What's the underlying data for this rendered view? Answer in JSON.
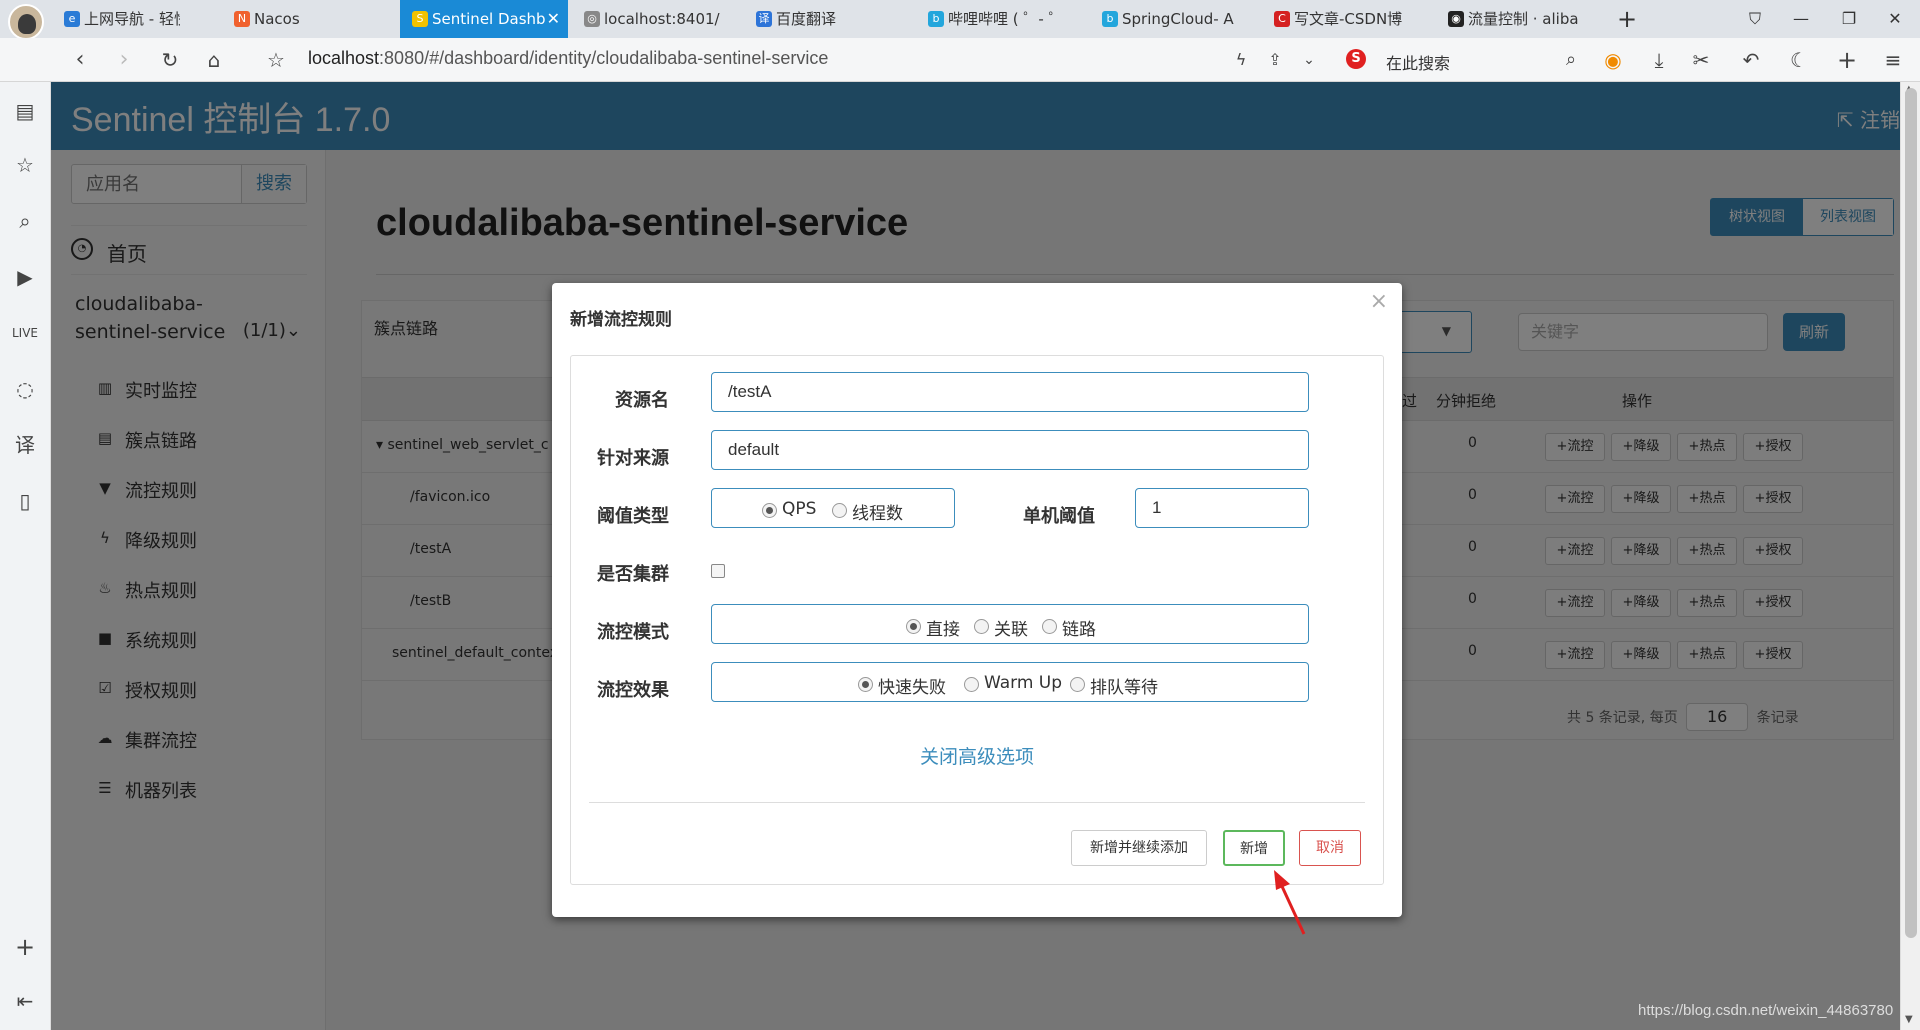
{
  "browser": {
    "tabs": [
      {
        "label": "上网导航 - 轻快上",
        "icon": "e"
      },
      {
        "label": "Nacos",
        "icon": "N"
      },
      {
        "label": "Sentinel Dashb",
        "icon": "S"
      },
      {
        "label": "localhost:8401/",
        "icon": "◎"
      },
      {
        "label": "百度翻译",
        "icon": "译"
      },
      {
        "label": "哔哩哔哩 ( ゜- ゜",
        "icon": "b"
      },
      {
        "label": "SpringCloud- A",
        "icon": "b"
      },
      {
        "label": "写文章-CSDN博",
        "icon": "C"
      },
      {
        "label": "流量控制 · aliba",
        "icon": "◉"
      }
    ],
    "url_host": "localhost",
    "url_rest": ":8080/#/dashboard/identity/cloudalibaba-sentinel-service",
    "search_placeholder": "在此搜索"
  },
  "app": {
    "brand": "Sentinel 控制台 1.7.0",
    "logout": "注销",
    "app_search_placeholder": "应用名",
    "app_search_button": "搜索",
    "home": "首页",
    "app_name": "cloudalibaba-sentinel-service",
    "app_count": "(1/1)",
    "menu": [
      "实时监控",
      "簇点链路",
      "流控规则",
      "降级规则",
      "热点规则",
      "系统规则",
      "授权规则",
      "集群流控",
      "机器列表"
    ],
    "page_title": "cloudalibaba-sentinel-service",
    "view_tree": "树状视图",
    "view_list": "列表视图",
    "panel_title": "簇点链路",
    "keyword_placeholder": "关键字",
    "refresh": "刷新",
    "col_pass": "过",
    "col_reject": "分钟拒绝",
    "col_ops": "操作",
    "rows": [
      {
        "resource": "sentinel_web_servlet_c",
        "reject": "0"
      },
      {
        "resource": "/favicon.ico",
        "reject": "0"
      },
      {
        "resource": "/testA",
        "reject": "0"
      },
      {
        "resource": "/testB",
        "reject": "0"
      },
      {
        "resource": "sentinel_default_contex",
        "reject": "0"
      }
    ],
    "ops": [
      "+流控",
      "+降级",
      "+热点",
      "+授权"
    ],
    "pager_prefix": "共 5 条记录, 每页",
    "pager_size": "16",
    "pager_suffix": "条记录"
  },
  "modal": {
    "title": "新增流控规则",
    "resource_label": "资源名",
    "resource_value": "/testA",
    "source_label": "针对来源",
    "source_value": "default",
    "threshold_type_label": "阈值类型",
    "threshold_type_options": [
      "QPS",
      "线程数"
    ],
    "threshold_label": "单机阈值",
    "threshold_value": "1",
    "cluster_label": "是否集群",
    "mode_label": "流控模式",
    "mode_options": [
      "直接",
      "关联",
      "链路"
    ],
    "effect_label": "流控效果",
    "effect_options": [
      "快速失败",
      "Warm Up",
      "排队等待"
    ],
    "advanced_link": "关闭高级选项",
    "btn_add_continue": "新增并继续添加",
    "btn_add": "新增",
    "btn_cancel": "取消"
  },
  "watermark": "https://blog.csdn.net/weixin_44863780",
  "colors": {
    "primary": "#3c8dbc",
    "tab_active": "#1a8ad6",
    "success_border": "#5cb85c",
    "danger": "#d9534f"
  }
}
